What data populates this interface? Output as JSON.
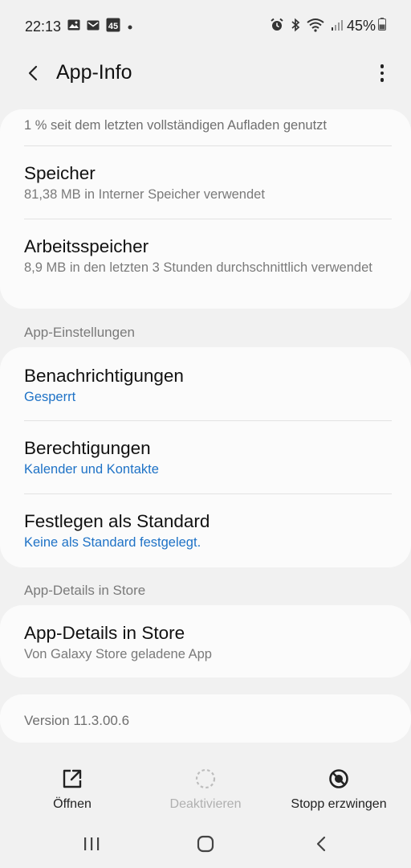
{
  "status_bar": {
    "time": "22:13",
    "battery_percent": "45%",
    "left_icons": [
      "gallery-icon",
      "mail-icon",
      "calendar-45-icon",
      "dot-icon"
    ],
    "right_icons": [
      "alarm-icon",
      "bluetooth-icon",
      "wifi-icon",
      "signal-icon",
      "battery-icon"
    ],
    "calendar_badge": "45"
  },
  "app_bar": {
    "title": "App-Info"
  },
  "usage_card": {
    "battery_usage": "1 % seit dem letzten vollständigen Aufladen genutzt",
    "storage": {
      "title": "Speicher",
      "subtitle": "81,38 MB in Interner Speicher verwendet"
    },
    "memory": {
      "title": "Arbeitsspeicher",
      "subtitle": "8,9 MB in den letzten 3 Stunden durchschnittlich verwendet"
    }
  },
  "app_settings": {
    "header": "App-Einstellungen",
    "items": [
      {
        "title": "Benachrichtigungen",
        "subtitle": "Gesperrt"
      },
      {
        "title": "Berechtigungen",
        "subtitle": "Kalender und Kontakte"
      },
      {
        "title": "Festlegen als Standard",
        "subtitle": "Keine als Standard festgelegt."
      }
    ]
  },
  "store": {
    "header": "App-Details in Store",
    "title": "App-Details in Store",
    "subtitle": "Von Galaxy Store geladene App"
  },
  "version": "Version 11.3.00.6",
  "actions": {
    "open": "Öffnen",
    "disable": "Deaktivieren",
    "force_stop": "Stopp erzwingen"
  },
  "colors": {
    "background": "#f1f1f1",
    "card": "#fbfbfb",
    "accent_blue": "#1e72c6",
    "secondary_text": "#7a7a7a",
    "disabled_text": "#b0b0b0"
  }
}
